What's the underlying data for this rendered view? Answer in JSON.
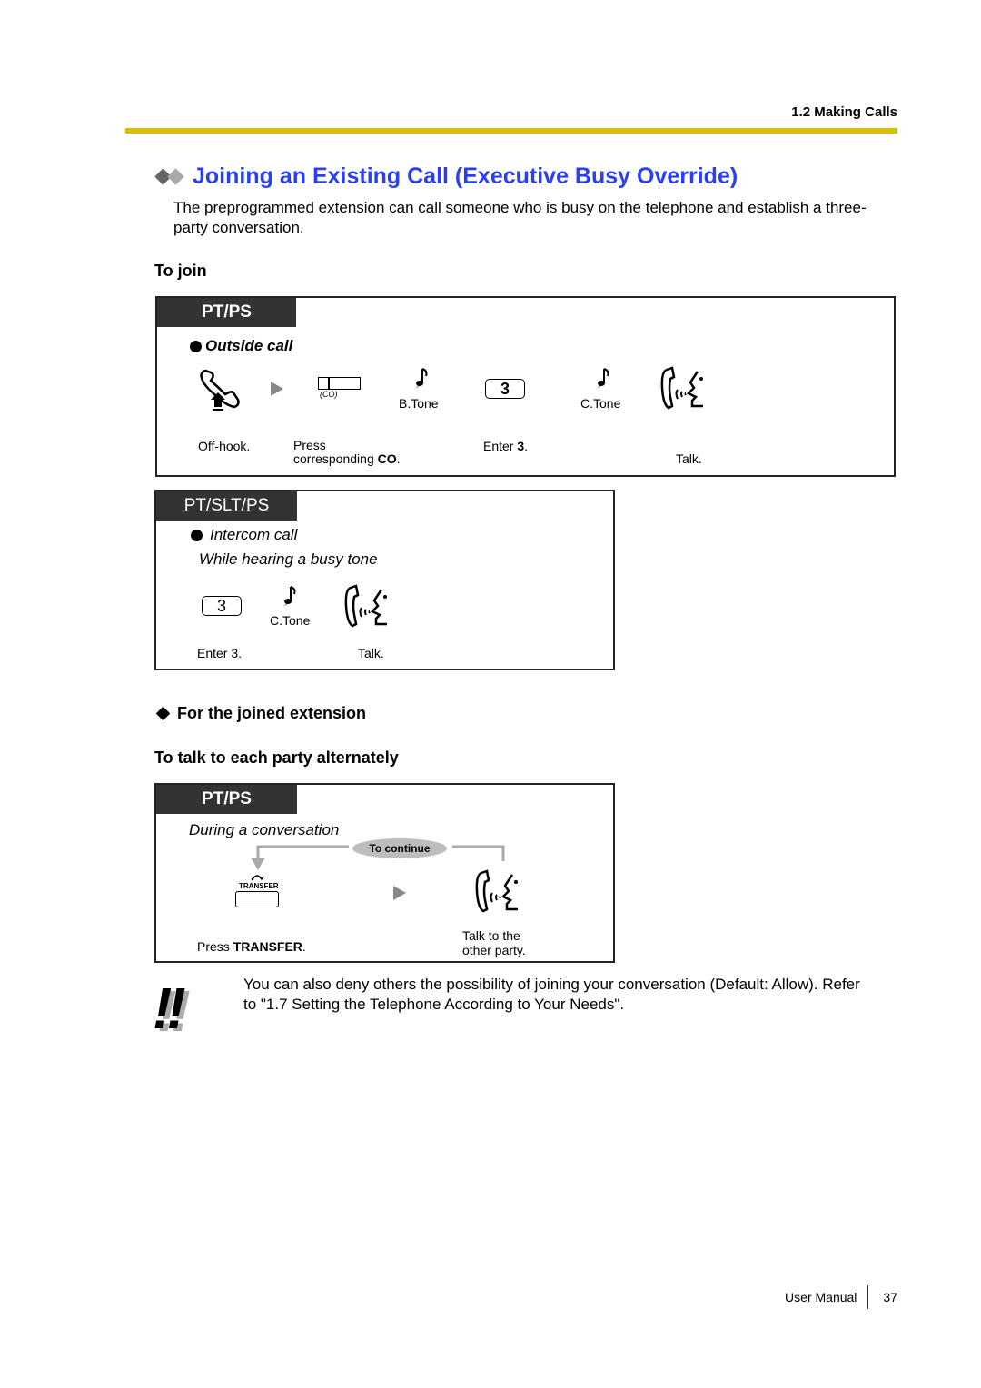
{
  "header": {
    "section": "1.2 Making Calls"
  },
  "title": "Joining an Existing Call (Executive Busy Override)",
  "intro": "The preprogrammed extension can call someone who is busy on the telephone and establish a three-party conversation.",
  "to_join": {
    "heading": "To join",
    "pt_ps_box": {
      "tab": "PT/PS",
      "subheading": "Outside call",
      "co_label": "(CO)",
      "b_tone": "B.Tone",
      "key": "3",
      "c_tone": "C.Tone",
      "steps": {
        "off_hook": "Off-hook.",
        "press_line1": "Press",
        "press_line2_prefix": "corresponding ",
        "press_line2_bold": "CO",
        "press_line2_suffix": ".",
        "enter_prefix": "Enter ",
        "enter_bold": "3",
        "enter_suffix": ".",
        "talk": "Talk."
      }
    },
    "pt_slt_ps_box": {
      "tab": "PT/SLT/PS",
      "subheading": "Intercom call",
      "condition": "While hearing a busy tone",
      "key": "3",
      "c_tone": "C.Tone",
      "enter": "Enter 3.",
      "talk": "Talk."
    }
  },
  "joined_extension": {
    "heading": "For the joined extension",
    "subheading": "To talk to each party alternately",
    "box": {
      "tab": "PT/PS",
      "condition": "During a conversation",
      "loop_label": "To continue",
      "transfer_key_label": "TRANSFER",
      "press_prefix": "Press ",
      "press_bold": "TRANSFER",
      "press_suffix": ".",
      "talk_line1": "Talk to the",
      "talk_line2": "other party."
    }
  },
  "note": {
    "icon": "!!",
    "text_line1": "You can also deny others the possibility of joining your conversation (Default: Allow). Refer",
    "text_line2": "to \"1.7 Setting the Telephone According to Your Needs\"."
  },
  "footer": {
    "label": "User Manual",
    "page": "37"
  },
  "colors": {
    "title": "#2a3ef2",
    "rule": "#dcc000",
    "tab_bg": "#333333"
  }
}
